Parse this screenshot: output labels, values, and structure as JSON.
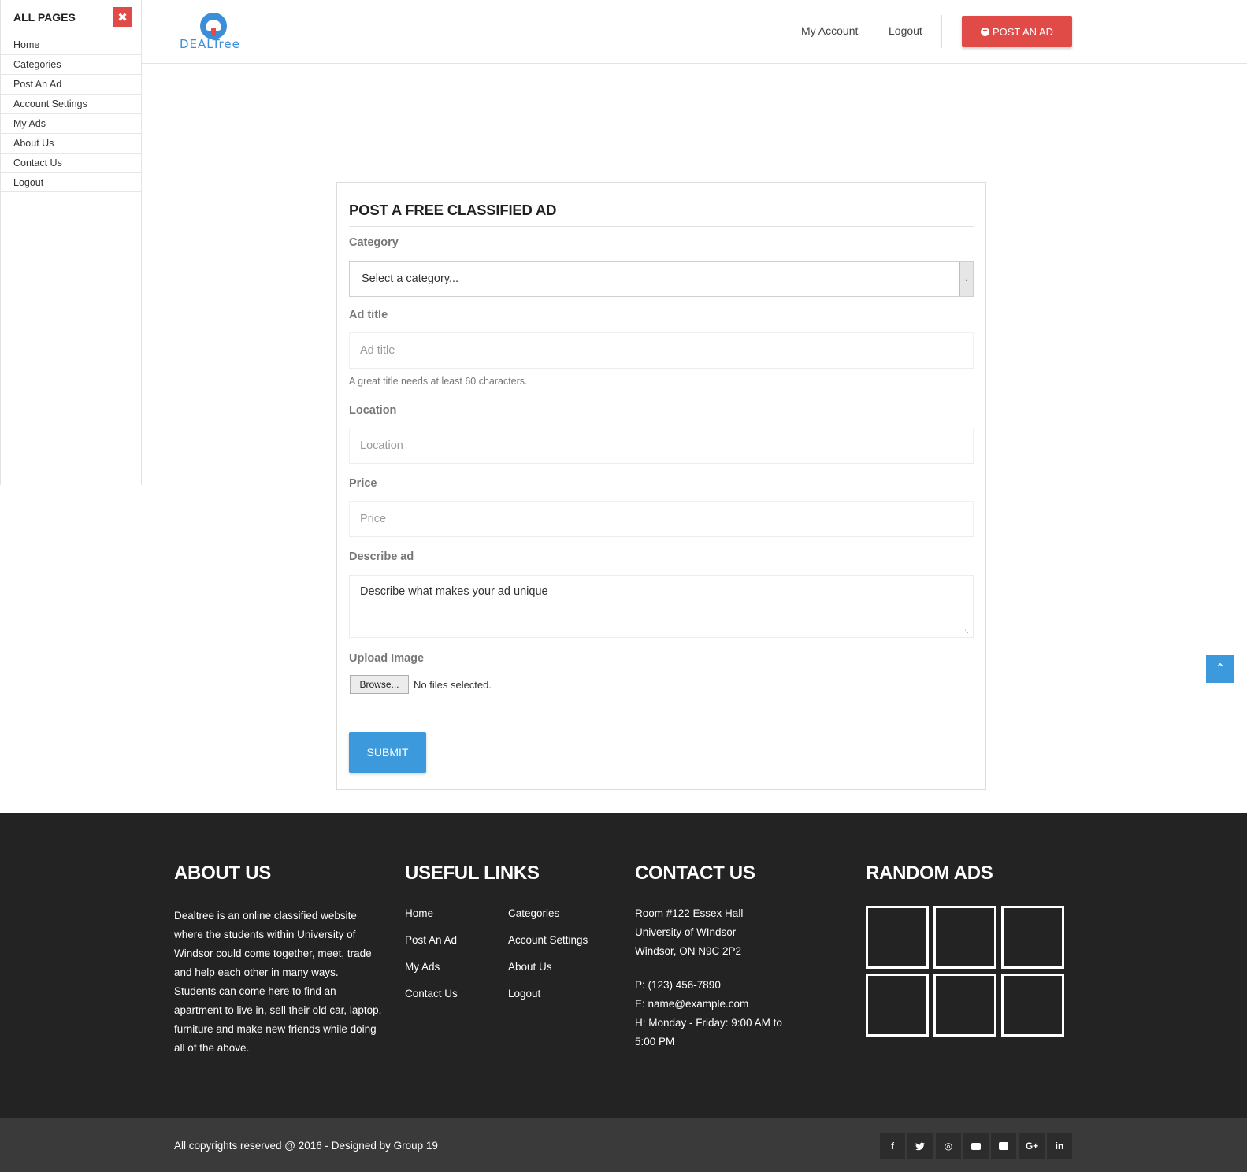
{
  "sidebar": {
    "title": "ALL PAGES",
    "close_glyph": "✖",
    "items": [
      "Home",
      "Categories",
      "Post An Ad",
      "Account Settings",
      "My Ads",
      "About Us",
      "Contact Us",
      "Logout"
    ]
  },
  "header": {
    "logo_text": "DEALTree",
    "nav": {
      "my_account": "My Account",
      "logout": "Logout"
    },
    "post_ad_button": "POST AN AD"
  },
  "form": {
    "title": "POST A FREE CLASSIFIED AD",
    "category_label": "Category",
    "category_value": "Select a category...",
    "ad_title_label": "Ad title",
    "ad_title_placeholder": "Ad title",
    "ad_title_help": "A great title needs at least 60 characters.",
    "location_label": "Location",
    "location_placeholder": "Location",
    "price_label": "Price",
    "price_placeholder": "Price",
    "describe_label": "Describe ad",
    "describe_placeholder": "Describe what makes your ad unique",
    "upload_label": "Upload Image",
    "browse_button": "Browse...",
    "file_status": "No files selected.",
    "submit_button": "SUBMIT"
  },
  "footer": {
    "about_heading": "ABOUT US",
    "about_text": "Dealtree is an online classified website where the students within University of Windsor could come together, meet, trade and help each other in many ways. Students can come here to find an apartment to live in, sell their old car, laptop, furniture and make new friends while doing all of the above.",
    "links_heading": "USEFUL LINKS",
    "links": [
      "Home",
      "Categories",
      "Post An Ad",
      "Account Settings",
      "My Ads",
      "About Us",
      "Contact Us",
      "Logout"
    ],
    "contact_heading": "CONTACT US",
    "address": [
      "Room #122 Essex Hall",
      "University of WIndsor",
      "Windsor, ON N9C 2P2"
    ],
    "phone": "P: (123) 456-7890",
    "email": "E: name@example.com",
    "hours_line1": "H: Monday - Friday: 9:00 AM to",
    "hours_line2": "5:00 PM",
    "random_ads_heading": "RANDOM ADS",
    "copyright": "All copyrights reserved @ 2016 - Designed by Group 19",
    "social": [
      {
        "name": "facebook-icon",
        "glyph": "f"
      },
      {
        "name": "twitter-icon",
        "glyph": "🐦"
      },
      {
        "name": "dribbble-icon",
        "glyph": "◎"
      },
      {
        "name": "flickr-icon",
        "glyph": "●●"
      },
      {
        "name": "youtube-icon",
        "glyph": "▶"
      },
      {
        "name": "google-plus-icon",
        "glyph": "G+"
      },
      {
        "name": "linkedin-icon",
        "glyph": "in"
      }
    ]
  },
  "colors": {
    "accent_red": "#e04b48",
    "accent_blue": "#3c99dc",
    "footer_bg": "#232323",
    "bottom_bar_bg": "#3a3a3a"
  },
  "icons": {
    "back_to_top": "chevron-up-icon",
    "select_arrow": "chevron-down-icon"
  }
}
